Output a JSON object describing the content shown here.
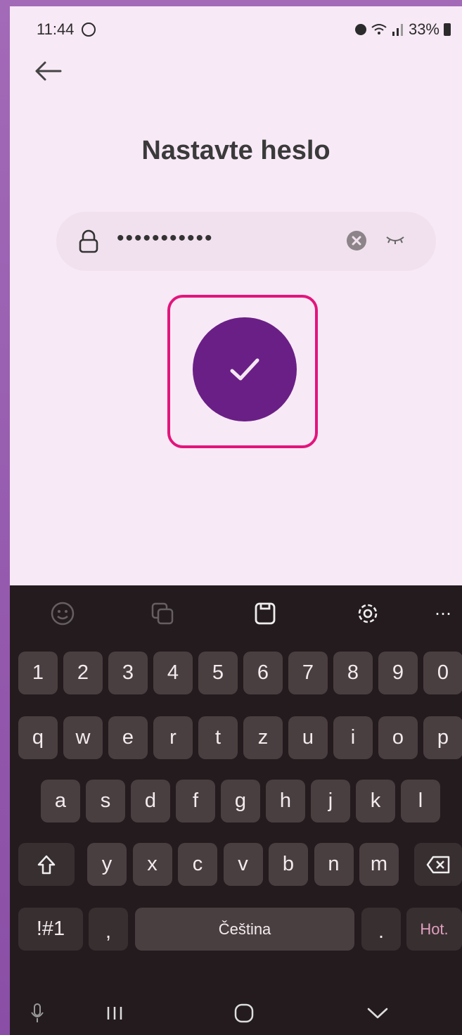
{
  "status_bar": {
    "time": "11:44",
    "battery": "33%"
  },
  "screen": {
    "title": "Nastavte heslo",
    "password_value": "•••••••••••",
    "accent_color": "#6a1f86",
    "highlight_color": "#e3157c"
  },
  "keyboard": {
    "toolbar": [
      "emoji-icon",
      "text-recognition-icon",
      "clipboard-icon",
      "settings-icon",
      "more-icon"
    ],
    "row_numbers": [
      "1",
      "2",
      "3",
      "4",
      "5",
      "6",
      "7",
      "8",
      "9",
      "0"
    ],
    "row_1": [
      "q",
      "w",
      "e",
      "r",
      "t",
      "z",
      "u",
      "i",
      "o",
      "p"
    ],
    "row_2": [
      "a",
      "s",
      "d",
      "f",
      "g",
      "h",
      "j",
      "k",
      "l"
    ],
    "row_3": [
      "y",
      "x",
      "c",
      "v",
      "b",
      "n",
      "m"
    ],
    "symbols_label": "!#1",
    "comma_label": ",",
    "space_label": "Čeština",
    "period_label": ".",
    "done_label": "Hot."
  }
}
